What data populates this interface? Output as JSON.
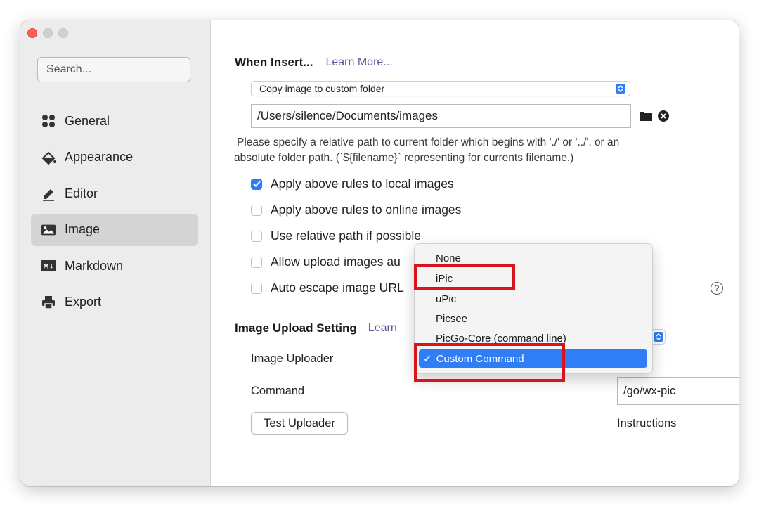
{
  "sidebar": {
    "search_placeholder": "Search...",
    "items": [
      {
        "label": "General",
        "icon": "grid-dots-icon"
      },
      {
        "label": "Appearance",
        "icon": "paint-bucket-icon"
      },
      {
        "label": "Editor",
        "icon": "pencil-icon"
      },
      {
        "label": "Image",
        "icon": "image-icon",
        "active": true
      },
      {
        "label": "Markdown",
        "icon": "markdown-icon"
      },
      {
        "label": "Export",
        "icon": "printer-icon"
      }
    ],
    "markdown_badge": "M↓"
  },
  "insert": {
    "title": "When Insert...",
    "learn_more": "Learn More...",
    "action_selected": "Copy image to custom folder",
    "folder_path": "/Users/silence/Documents/images",
    "hint_line1": "Please specify a relative path to current folder which begins with './' or '../', or an",
    "hint_line2": "absolute folder path. (`${filename}` representing for currents filename.)",
    "checkboxes": [
      {
        "label": "Apply above rules to local images",
        "checked": true
      },
      {
        "label": "Apply above rules to online images",
        "checked": false
      },
      {
        "label": "Use relative path if possible",
        "checked": false
      },
      {
        "label": "Allow upload images au",
        "checked": false
      },
      {
        "label": "Auto escape image URL",
        "checked": false
      }
    ],
    "help_symbol": "?"
  },
  "upload": {
    "title": "Image Upload Setting",
    "learn_more": "Learn",
    "uploader_label": "Image Uploader",
    "command_label": "Command",
    "command_value": "/go/wx-pic",
    "test_button": "Test Uploader",
    "instructions": "Instructions"
  },
  "uploader_menu": {
    "options": [
      "None",
      "iPic",
      "uPic",
      "Picsee",
      "PicGo-Core (command line)",
      "Custom Command"
    ],
    "selected": "Custom Command",
    "checkmark": "✓"
  },
  "colors": {
    "accent": "#2f7ef5",
    "link": "#5b5a9c",
    "highlight_box": "#d5141b"
  }
}
